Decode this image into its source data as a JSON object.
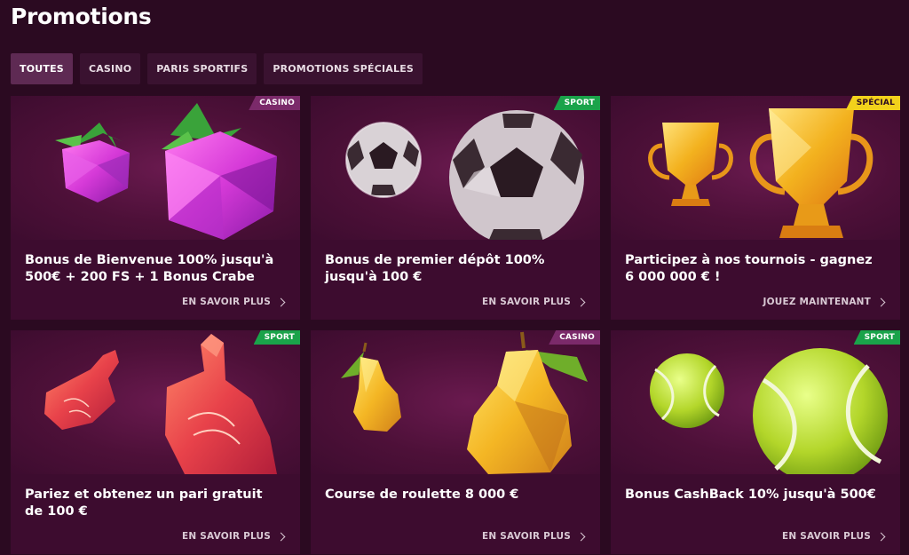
{
  "page_title": "Promotions",
  "tabs": [
    {
      "label": "TOUTES",
      "active": true
    },
    {
      "label": "CASINO",
      "active": false
    },
    {
      "label": "PARIS SPORTIFS",
      "active": false
    },
    {
      "label": "PROMOTIONS SPÉCIALES",
      "active": false
    }
  ],
  "cards": [
    {
      "badge": "CASINO",
      "badge_type": "casino",
      "icon": "raspberry-icon",
      "title": "Bonus de Bienvenue 100% jusqu'à 500€ + 200 FS + 1 Bonus Crabe",
      "link": "EN SAVOIR PLUS"
    },
    {
      "badge": "SPORT",
      "badge_type": "sport",
      "icon": "soccer-ball-icon",
      "title": "Bonus de premier dépôt 100% jusqu'à 100 €",
      "link": "EN SAVOIR PLUS"
    },
    {
      "badge": "SPÉCIAL",
      "badge_type": "special",
      "icon": "trophy-icon",
      "title": "Participez à nos tournois - gagnez 6 000 000 € !",
      "link": "JOUEZ MAINTENANT"
    },
    {
      "badge": "SPORT",
      "badge_type": "sport",
      "icon": "foam-finger-icon",
      "title": "Pariez et obtenez un pari gratuit de 100 €",
      "link": "EN SAVOIR PLUS"
    },
    {
      "badge": "CASINO",
      "badge_type": "casino",
      "icon": "pear-icon",
      "title": "Course de roulette 8 000 €",
      "link": "EN SAVOIR PLUS"
    },
    {
      "badge": "SPORT",
      "badge_type": "sport",
      "icon": "tennis-ball-icon",
      "title": "Bonus CashBack 10% jusqu'à 500€",
      "link": "EN SAVOIR PLUS"
    }
  ],
  "colors": {
    "background": "#2b0a21",
    "card": "#3d0c2f",
    "tab_active": "#5e2a53",
    "badge_casino": "#7b2a6a",
    "badge_sport": "#1aa34a",
    "badge_special": "#f2d21b"
  }
}
